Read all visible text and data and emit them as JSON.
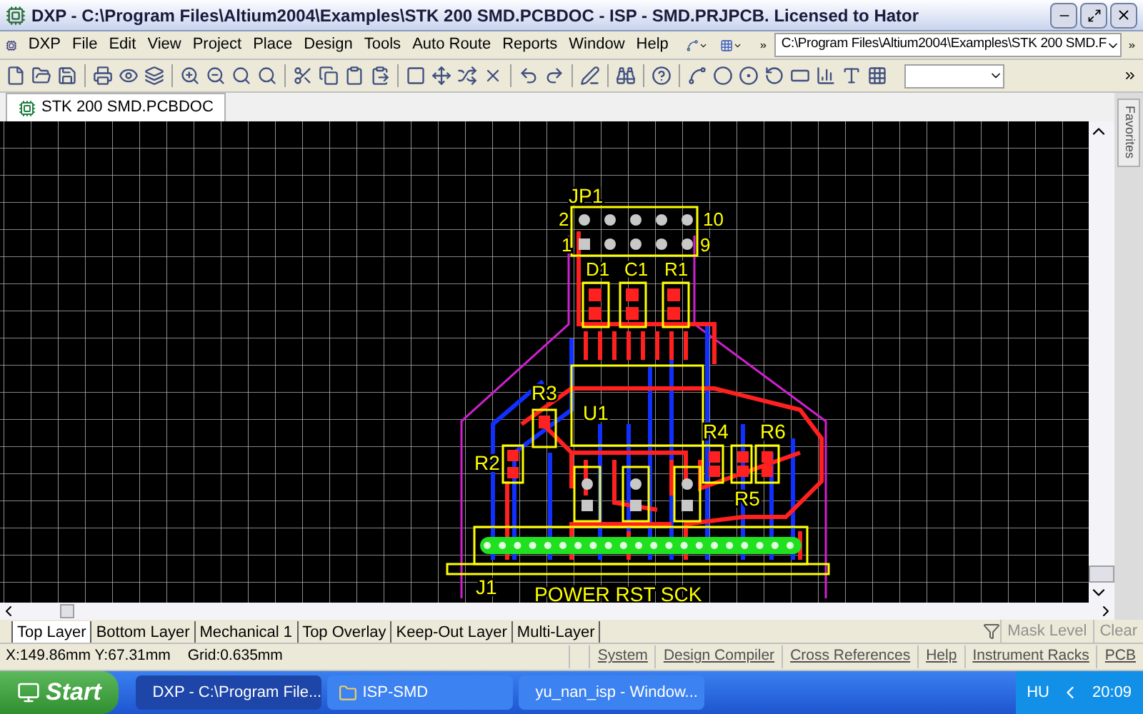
{
  "window": {
    "title": "DXP - C:\\Program Files\\Altium2004\\Examples\\STK 200 SMD.PCBDOC - ISP - SMD.PRJPCB. Licensed to Hator"
  },
  "menu": [
    "DXP",
    "File",
    "Edit",
    "View",
    "Project",
    "Place",
    "Design",
    "Tools",
    "Auto Route",
    "Reports",
    "Window",
    "Help"
  ],
  "path_field": {
    "value": "C:\\Program Files\\Altium2004\\Examples\\STK 200 SMD.F"
  },
  "document_tab": {
    "label": "STK 200 SMD.PCBDOC"
  },
  "side_panel": {
    "label": "Favorites"
  },
  "pcb_labels": [
    {
      "text": "JP1"
    },
    {
      "text": "2"
    },
    {
      "text": "10"
    },
    {
      "text": "1"
    },
    {
      "text": "9"
    },
    {
      "text": "D1"
    },
    {
      "text": "C1"
    },
    {
      "text": "R1"
    },
    {
      "text": "R3"
    },
    {
      "text": "U1"
    },
    {
      "text": "R2"
    },
    {
      "text": "R4"
    },
    {
      "text": "R6"
    },
    {
      "text": "R5"
    },
    {
      "text": "J1"
    },
    {
      "text": "POWER RST SCK"
    }
  ],
  "layer_tabs": [
    {
      "label": "Top Layer",
      "selected": true
    },
    {
      "label": "Bottom Layer",
      "selected": false
    },
    {
      "label": "Mechanical 1",
      "selected": false
    },
    {
      "label": "Top Overlay",
      "selected": false
    },
    {
      "label": "Keep-Out Layer",
      "selected": false
    },
    {
      "label": "Multi-Layer",
      "selected": false
    }
  ],
  "mask_buttons": [
    "Mask Level",
    "Clear"
  ],
  "status_bar": {
    "coordinates": "X:149.86mm Y:67.31mm",
    "grid": "Grid:0.635mm",
    "panels": [
      "System",
      "Design Compiler",
      "Cross References",
      "Help",
      "Instrument Racks",
      "PCB"
    ]
  },
  "taskbar": {
    "start": "Start",
    "tasks": [
      {
        "label": "DXP - C:\\Program File...",
        "selected": true
      },
      {
        "label": "ISP-SMD",
        "selected": false
      },
      {
        "label": "yu_nan_isp - Window...",
        "selected": false
      }
    ],
    "language": "HU",
    "clock": "20:09"
  }
}
